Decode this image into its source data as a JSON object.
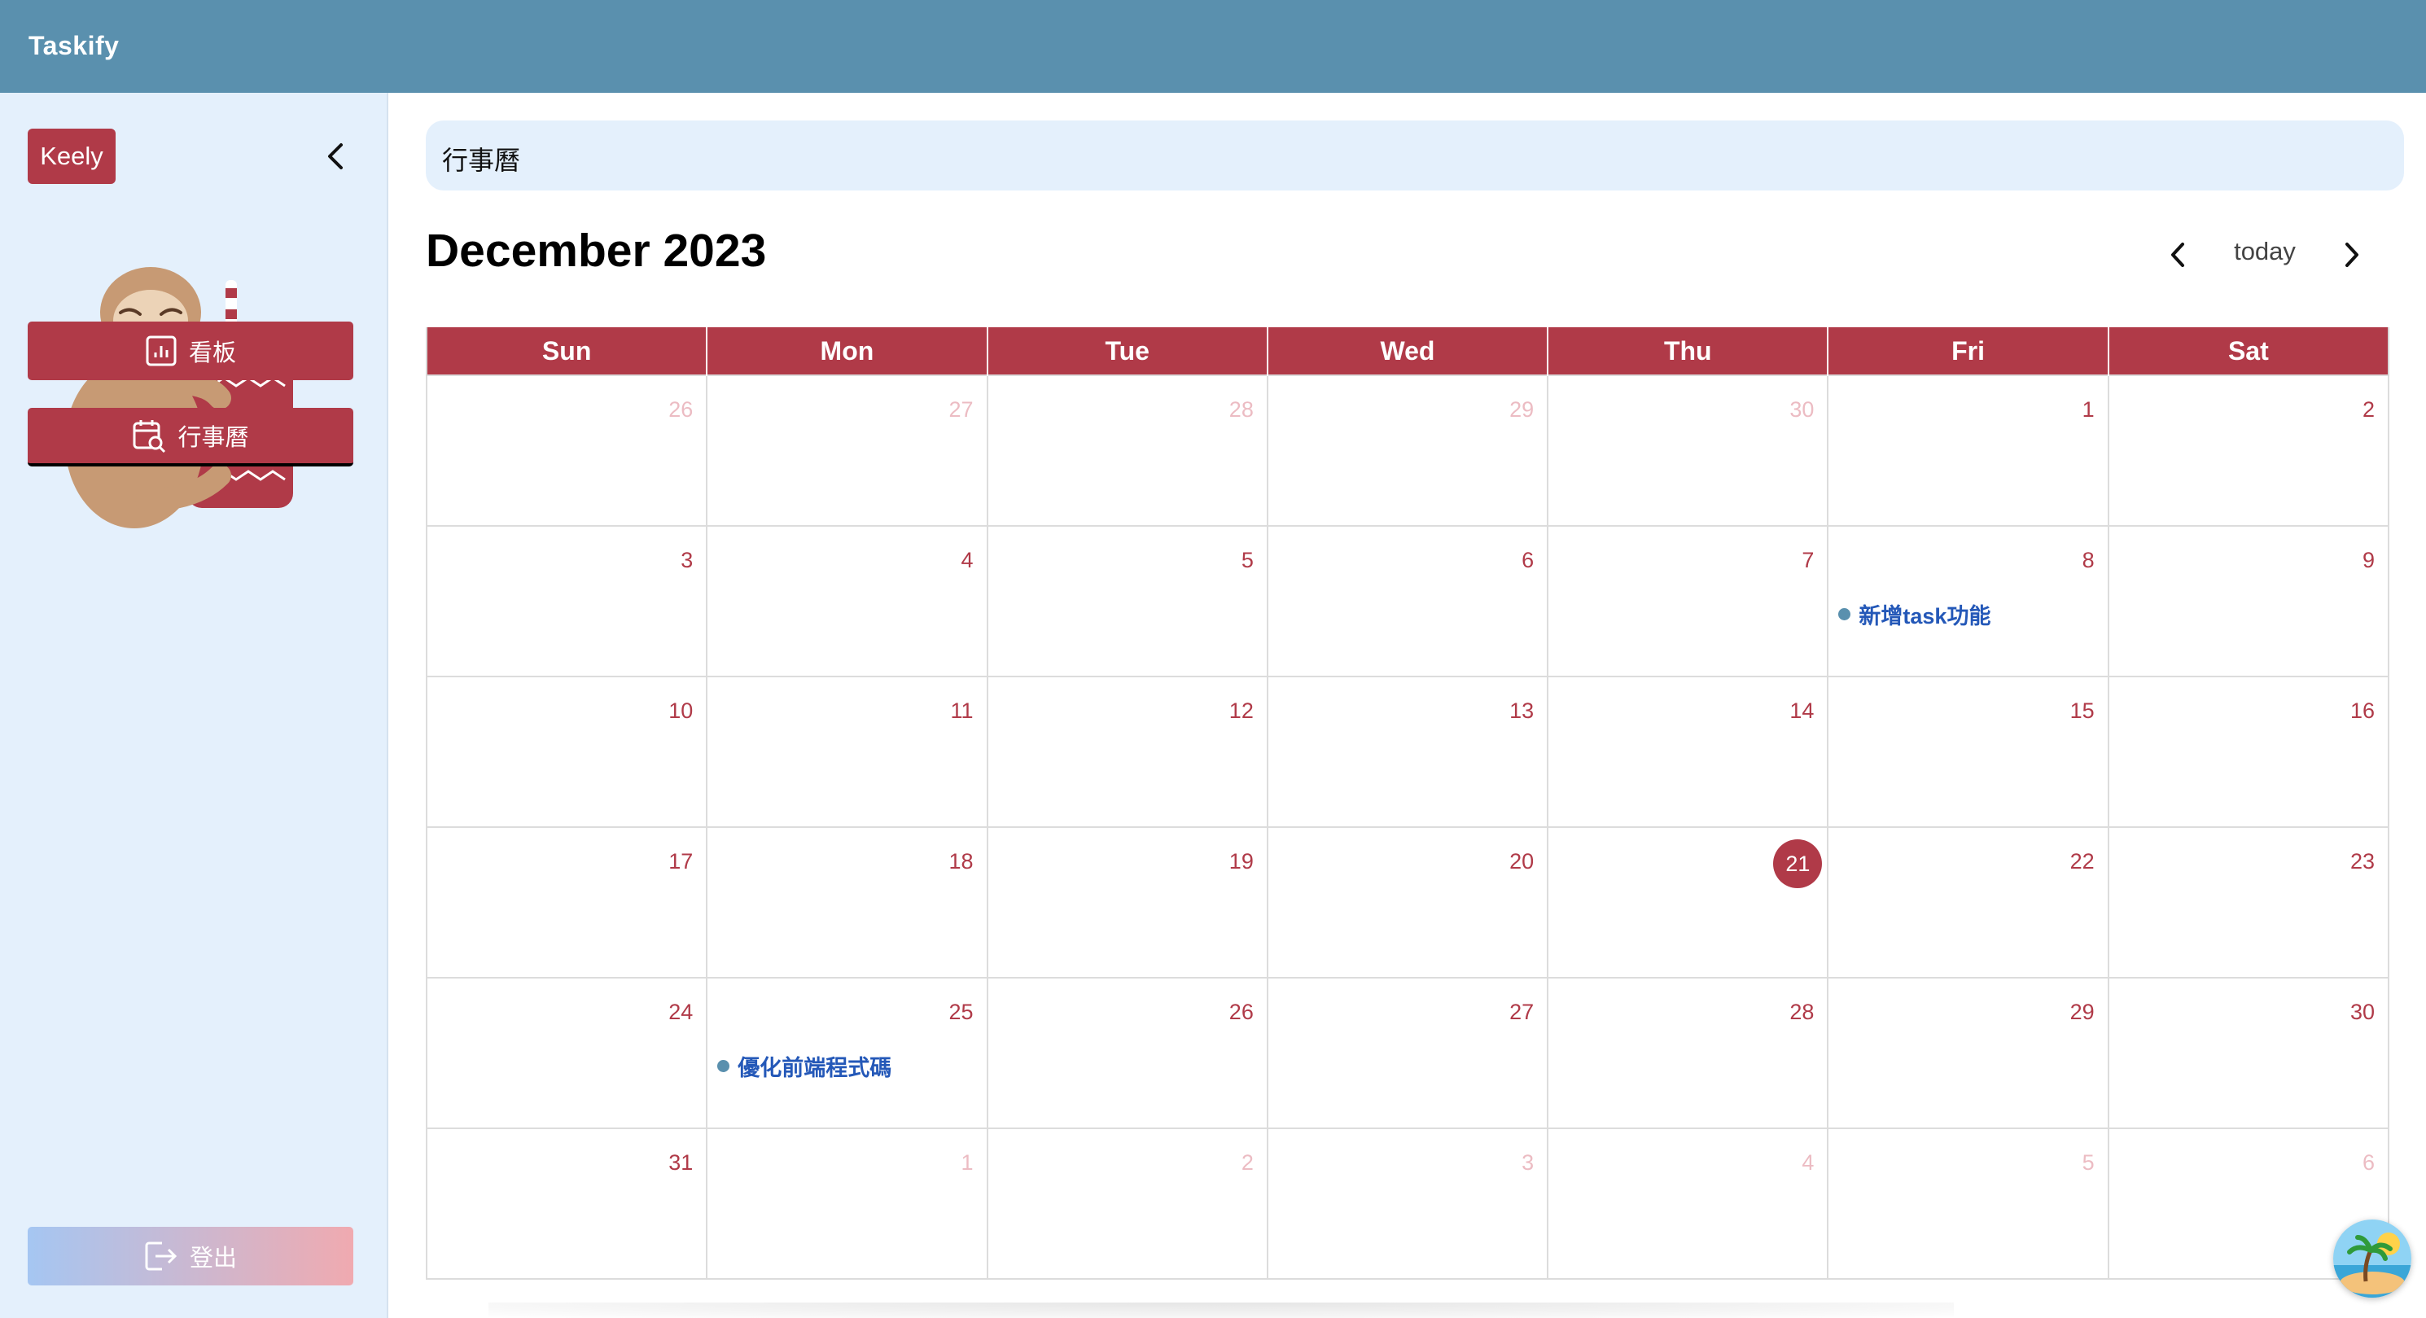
{
  "app": {
    "name": "Taskify"
  },
  "sidebar": {
    "user_name": "Keely",
    "nav": [
      {
        "label": "看板",
        "icon": "chart-board-icon"
      },
      {
        "label": "行事曆",
        "icon": "calendar-search-icon"
      }
    ],
    "logout_label": "登出"
  },
  "header": {
    "title": "行事曆"
  },
  "calendar": {
    "title": "December 2023",
    "today_label": "today",
    "weekdays": [
      "Sun",
      "Mon",
      "Tue",
      "Wed",
      "Thu",
      "Fri",
      "Sat"
    ],
    "weeks": [
      [
        {
          "d": "26",
          "other": true
        },
        {
          "d": "27",
          "other": true
        },
        {
          "d": "28",
          "other": true
        },
        {
          "d": "29",
          "other": true
        },
        {
          "d": "30",
          "other": true
        },
        {
          "d": "1"
        },
        {
          "d": "2"
        }
      ],
      [
        {
          "d": "3"
        },
        {
          "d": "4"
        },
        {
          "d": "5"
        },
        {
          "d": "6"
        },
        {
          "d": "7"
        },
        {
          "d": "8",
          "event": "新增task功能"
        },
        {
          "d": "9"
        }
      ],
      [
        {
          "d": "10"
        },
        {
          "d": "11"
        },
        {
          "d": "12"
        },
        {
          "d": "13"
        },
        {
          "d": "14"
        },
        {
          "d": "15"
        },
        {
          "d": "16"
        }
      ],
      [
        {
          "d": "17"
        },
        {
          "d": "18"
        },
        {
          "d": "19"
        },
        {
          "d": "20"
        },
        {
          "d": "21",
          "today": true
        },
        {
          "d": "22"
        },
        {
          "d": "23"
        }
      ],
      [
        {
          "d": "24"
        },
        {
          "d": "25",
          "event": "優化前端程式碼"
        },
        {
          "d": "26"
        },
        {
          "d": "27"
        },
        {
          "d": "28"
        },
        {
          "d": "29"
        },
        {
          "d": "30"
        }
      ],
      [
        {
          "d": "31"
        },
        {
          "d": "1",
          "other": true
        },
        {
          "d": "2",
          "other": true
        },
        {
          "d": "3",
          "other": true
        },
        {
          "d": "4",
          "other": true
        },
        {
          "d": "5",
          "other": true
        },
        {
          "d": "6",
          "other": true
        }
      ]
    ]
  },
  "colors": {
    "topbar": "#5a90ae",
    "accent": "#b03a48",
    "sidebar_bg": "#e4f0fc",
    "event_text": "#2458b8",
    "event_dot": "#5a90ae"
  }
}
